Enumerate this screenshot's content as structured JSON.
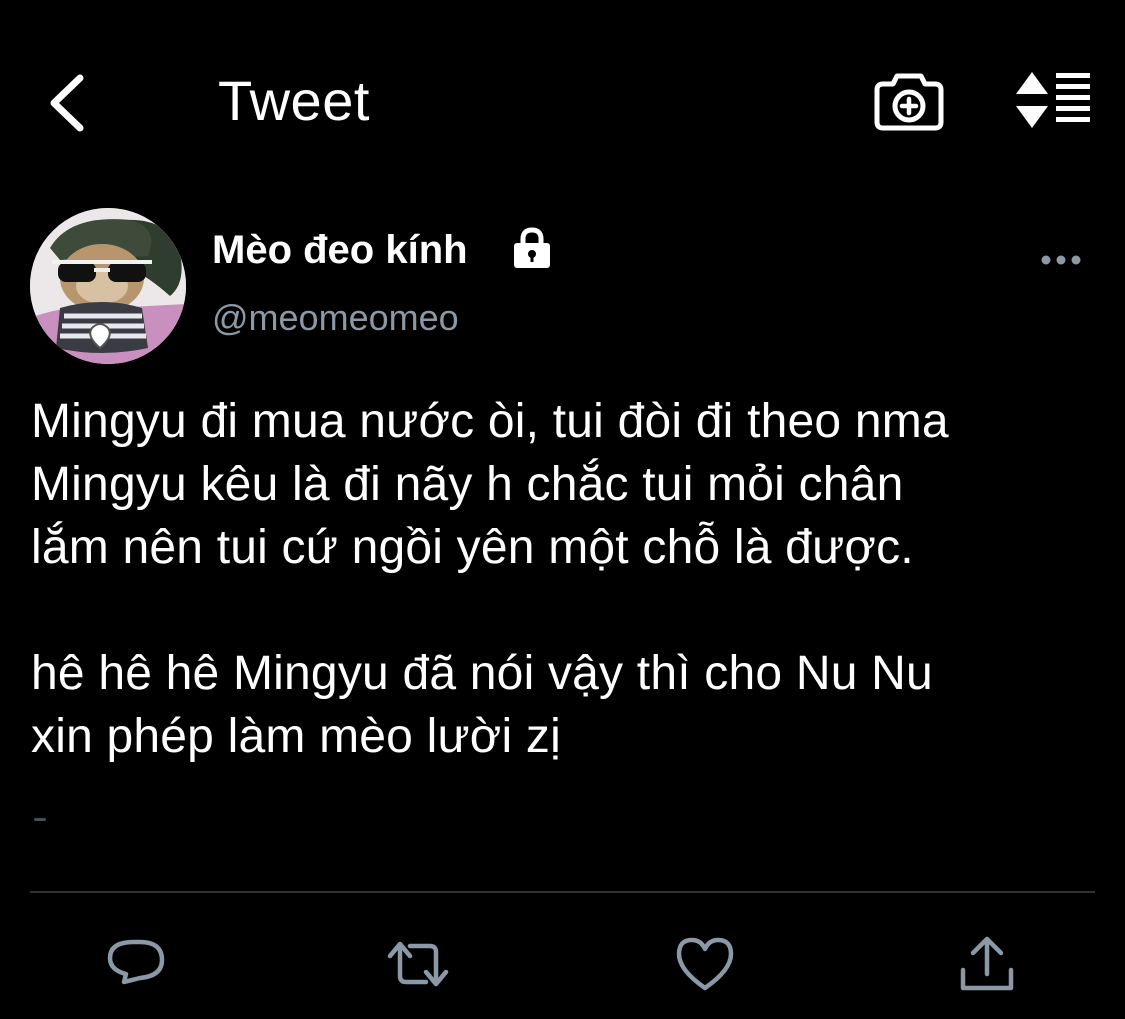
{
  "header": {
    "title": "Tweet",
    "back_icon": "chevron-left-icon",
    "camera_icon": "camera-add-icon",
    "sort_icon": "sort-lines-icon"
  },
  "author": {
    "display_name": "Mèo đeo kính",
    "handle": "@meomeomeo",
    "protected_icon": "lock-icon",
    "avatar_description": "cat wearing sunglasses and a green hat",
    "more_icon": "more-horizontal-icon"
  },
  "tweet": {
    "paragraphs": [
      [
        "Mingyu đi mua nước òi, tui đòi đi theo nma",
        "Mingyu kêu là đi nãy h chắc tui mỏi chân",
        "lắm nên tui cứ ngồi yên một chỗ là được."
      ],
      [
        "hê hê hê Mingyu đã nói vậy thì cho Nu Nu",
        "xin phép làm mèo lười zị"
      ]
    ]
  },
  "actions": [
    {
      "name": "reply",
      "icon": "reply-icon"
    },
    {
      "name": "retweet",
      "icon": "retweet-icon"
    },
    {
      "name": "like",
      "icon": "heart-icon"
    },
    {
      "name": "share",
      "icon": "share-icon"
    }
  ],
  "colors": {
    "background": "#000000",
    "text": "#ffffff",
    "secondary_text": "#8b98a5",
    "action_icon": "#8b98a5",
    "divider": "#2f3336"
  }
}
